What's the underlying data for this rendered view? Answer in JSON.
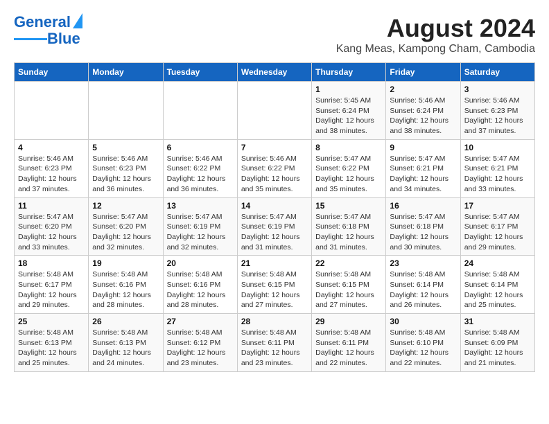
{
  "header": {
    "logo_line1": "General",
    "logo_line2": "Blue",
    "main_title": "August 2024",
    "sub_title": "Kang Meas, Kampong Cham, Cambodia"
  },
  "calendar": {
    "weekdays": [
      "Sunday",
      "Monday",
      "Tuesday",
      "Wednesday",
      "Thursday",
      "Friday",
      "Saturday"
    ],
    "weeks": [
      [
        {
          "day": "",
          "info": ""
        },
        {
          "day": "",
          "info": ""
        },
        {
          "day": "",
          "info": ""
        },
        {
          "day": "",
          "info": ""
        },
        {
          "day": "1",
          "info": "Sunrise: 5:45 AM\nSunset: 6:24 PM\nDaylight: 12 hours\nand 38 minutes."
        },
        {
          "day": "2",
          "info": "Sunrise: 5:46 AM\nSunset: 6:24 PM\nDaylight: 12 hours\nand 38 minutes."
        },
        {
          "day": "3",
          "info": "Sunrise: 5:46 AM\nSunset: 6:23 PM\nDaylight: 12 hours\nand 37 minutes."
        }
      ],
      [
        {
          "day": "4",
          "info": "Sunrise: 5:46 AM\nSunset: 6:23 PM\nDaylight: 12 hours\nand 37 minutes."
        },
        {
          "day": "5",
          "info": "Sunrise: 5:46 AM\nSunset: 6:23 PM\nDaylight: 12 hours\nand 36 minutes."
        },
        {
          "day": "6",
          "info": "Sunrise: 5:46 AM\nSunset: 6:22 PM\nDaylight: 12 hours\nand 36 minutes."
        },
        {
          "day": "7",
          "info": "Sunrise: 5:46 AM\nSunset: 6:22 PM\nDaylight: 12 hours\nand 35 minutes."
        },
        {
          "day": "8",
          "info": "Sunrise: 5:47 AM\nSunset: 6:22 PM\nDaylight: 12 hours\nand 35 minutes."
        },
        {
          "day": "9",
          "info": "Sunrise: 5:47 AM\nSunset: 6:21 PM\nDaylight: 12 hours\nand 34 minutes."
        },
        {
          "day": "10",
          "info": "Sunrise: 5:47 AM\nSunset: 6:21 PM\nDaylight: 12 hours\nand 33 minutes."
        }
      ],
      [
        {
          "day": "11",
          "info": "Sunrise: 5:47 AM\nSunset: 6:20 PM\nDaylight: 12 hours\nand 33 minutes."
        },
        {
          "day": "12",
          "info": "Sunrise: 5:47 AM\nSunset: 6:20 PM\nDaylight: 12 hours\nand 32 minutes."
        },
        {
          "day": "13",
          "info": "Sunrise: 5:47 AM\nSunset: 6:19 PM\nDaylight: 12 hours\nand 32 minutes."
        },
        {
          "day": "14",
          "info": "Sunrise: 5:47 AM\nSunset: 6:19 PM\nDaylight: 12 hours\nand 31 minutes."
        },
        {
          "day": "15",
          "info": "Sunrise: 5:47 AM\nSunset: 6:18 PM\nDaylight: 12 hours\nand 31 minutes."
        },
        {
          "day": "16",
          "info": "Sunrise: 5:47 AM\nSunset: 6:18 PM\nDaylight: 12 hours\nand 30 minutes."
        },
        {
          "day": "17",
          "info": "Sunrise: 5:47 AM\nSunset: 6:17 PM\nDaylight: 12 hours\nand 29 minutes."
        }
      ],
      [
        {
          "day": "18",
          "info": "Sunrise: 5:48 AM\nSunset: 6:17 PM\nDaylight: 12 hours\nand 29 minutes."
        },
        {
          "day": "19",
          "info": "Sunrise: 5:48 AM\nSunset: 6:16 PM\nDaylight: 12 hours\nand 28 minutes."
        },
        {
          "day": "20",
          "info": "Sunrise: 5:48 AM\nSunset: 6:16 PM\nDaylight: 12 hours\nand 28 minutes."
        },
        {
          "day": "21",
          "info": "Sunrise: 5:48 AM\nSunset: 6:15 PM\nDaylight: 12 hours\nand 27 minutes."
        },
        {
          "day": "22",
          "info": "Sunrise: 5:48 AM\nSunset: 6:15 PM\nDaylight: 12 hours\nand 27 minutes."
        },
        {
          "day": "23",
          "info": "Sunrise: 5:48 AM\nSunset: 6:14 PM\nDaylight: 12 hours\nand 26 minutes."
        },
        {
          "day": "24",
          "info": "Sunrise: 5:48 AM\nSunset: 6:14 PM\nDaylight: 12 hours\nand 25 minutes."
        }
      ],
      [
        {
          "day": "25",
          "info": "Sunrise: 5:48 AM\nSunset: 6:13 PM\nDaylight: 12 hours\nand 25 minutes."
        },
        {
          "day": "26",
          "info": "Sunrise: 5:48 AM\nSunset: 6:13 PM\nDaylight: 12 hours\nand 24 minutes."
        },
        {
          "day": "27",
          "info": "Sunrise: 5:48 AM\nSunset: 6:12 PM\nDaylight: 12 hours\nand 23 minutes."
        },
        {
          "day": "28",
          "info": "Sunrise: 5:48 AM\nSunset: 6:11 PM\nDaylight: 12 hours\nand 23 minutes."
        },
        {
          "day": "29",
          "info": "Sunrise: 5:48 AM\nSunset: 6:11 PM\nDaylight: 12 hours\nand 22 minutes."
        },
        {
          "day": "30",
          "info": "Sunrise: 5:48 AM\nSunset: 6:10 PM\nDaylight: 12 hours\nand 22 minutes."
        },
        {
          "day": "31",
          "info": "Sunrise: 5:48 AM\nSunset: 6:09 PM\nDaylight: 12 hours\nand 21 minutes."
        }
      ]
    ]
  }
}
